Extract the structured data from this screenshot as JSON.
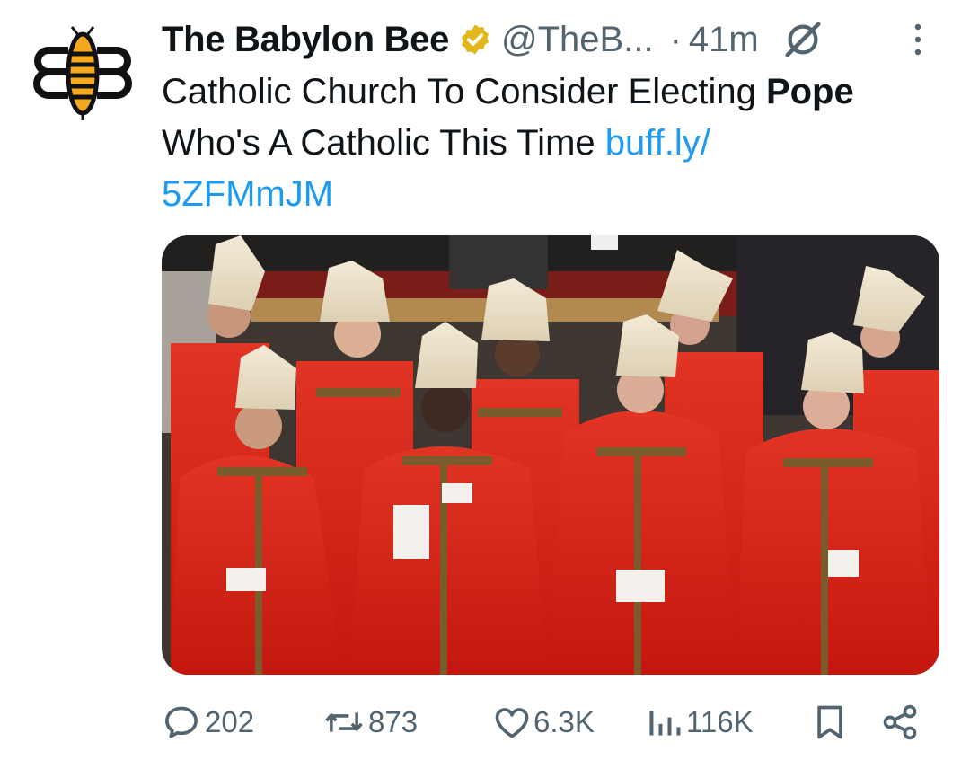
{
  "author": {
    "name": "The Babylon Bee",
    "handle": "@TheB...",
    "separator": "·",
    "time": "41m"
  },
  "tweet": {
    "text_before": "Catholic Church To Consider Electing ",
    "text_bold": "Pope",
    "text_after": " Who's A Catholic This Time ",
    "link_line1": "buff.ly/",
    "link_line2": "5ZFMmJM"
  },
  "stats": {
    "replies": "202",
    "reposts": "873",
    "likes": "6.3K",
    "views": "116K"
  },
  "colors": {
    "link": "#1d9bf0",
    "muted": "#536471",
    "verified_badge": "#e2b719",
    "robe_red": "#d9231a"
  },
  "icons": [
    "babylon-bee-logo",
    "verified-badge-icon",
    "grok-icon",
    "more-options-icon",
    "reply-icon",
    "repost-icon",
    "like-icon",
    "views-icon",
    "bookmark-icon",
    "share-icon"
  ]
}
